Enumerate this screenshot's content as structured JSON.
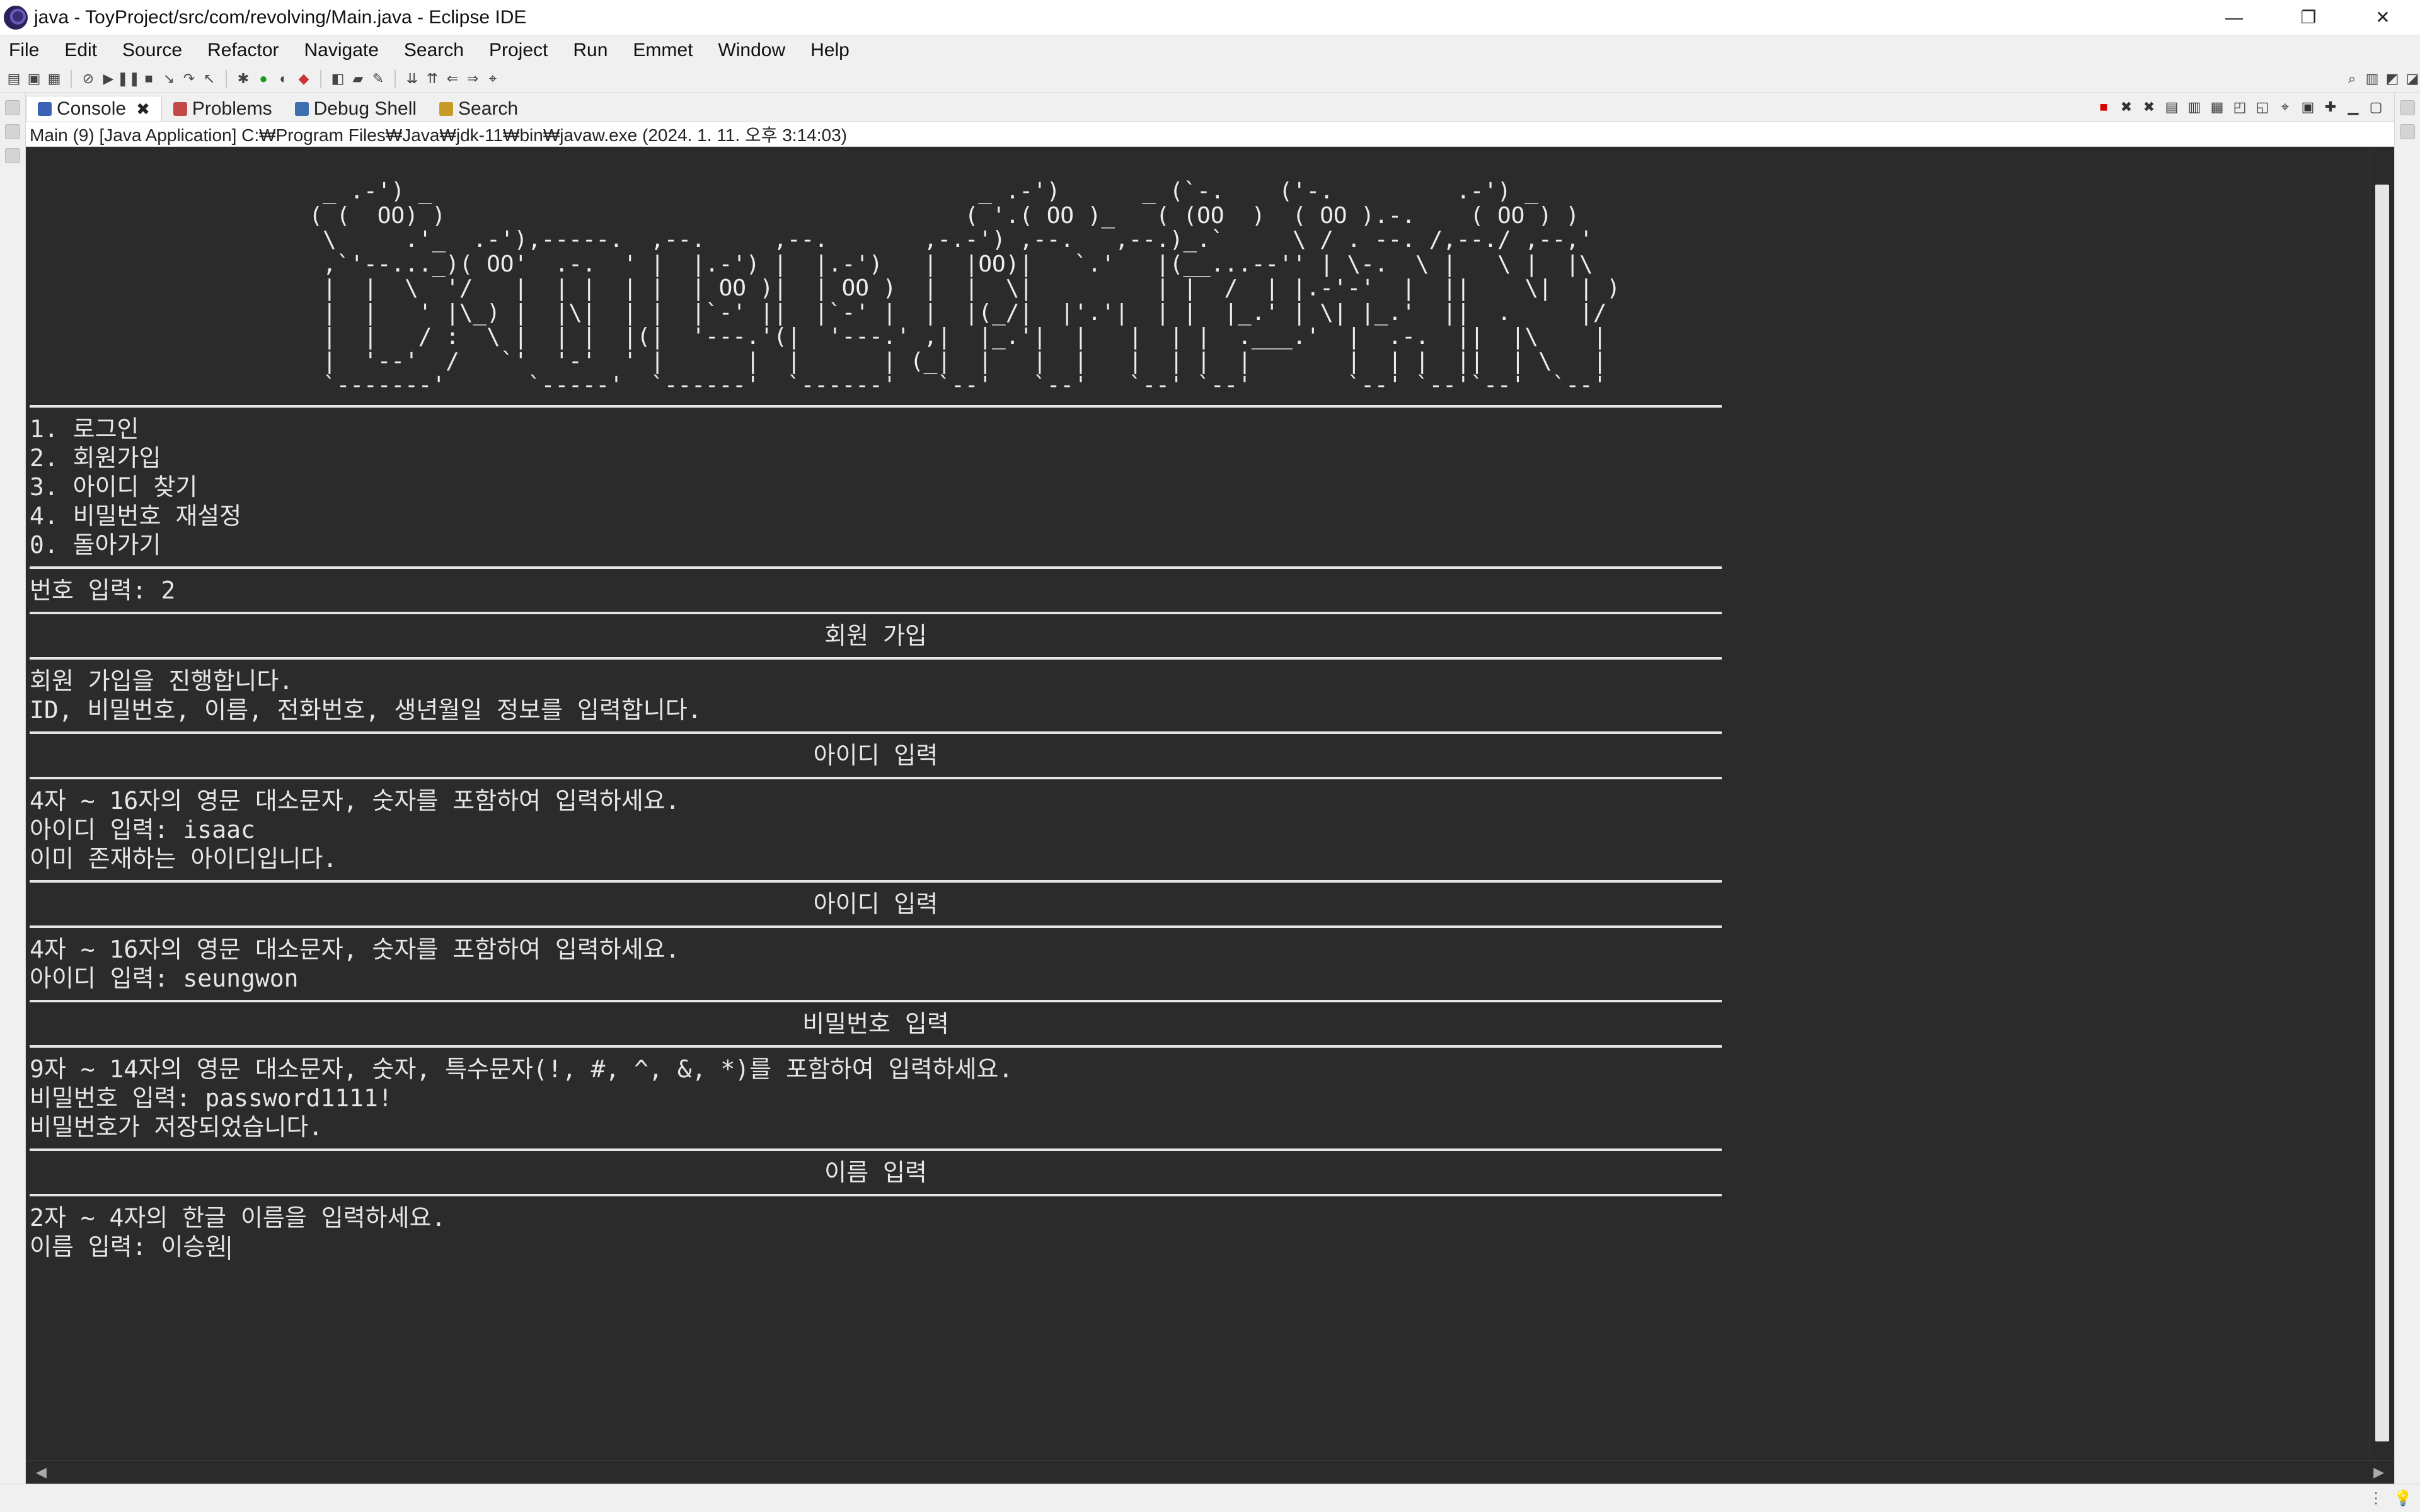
{
  "window": {
    "title": "java - ToyProject/src/com/revolving/Main.java - Eclipse IDE",
    "controls": {
      "minimize": "—",
      "maximize": "❐",
      "close": "✕"
    }
  },
  "menu": [
    "File",
    "Edit",
    "Source",
    "Refactor",
    "Navigate",
    "Search",
    "Project",
    "Run",
    "Emmet",
    "Window",
    "Help"
  ],
  "tabs": [
    {
      "label": "Console",
      "active": true,
      "icon": "console-icon"
    },
    {
      "label": "Problems",
      "active": false,
      "icon": "problems-icon"
    },
    {
      "label": "Debug Shell",
      "active": false,
      "icon": "debug-shell-icon"
    },
    {
      "label": "Search",
      "active": false,
      "icon": "search-icon"
    }
  ],
  "launch_info": "Main (9) [Java Application] C:₩Program Files₩Java₩jdk-11₩bin₩javaw.exe  (2024. 1. 11. 오후 3:14:03)",
  "console": {
    "ascii_banner": "   _ .-') _                                        _ .-')      _ (`-.    ('-.         .-') _\n  ( (  OO) )                                      ( '.( OO )_   ( (OO  )  ( OO ).-.    ( OO ) )\n   \\     .'_  .-'),-----.  ,--.     ,--.       ,-.-') ,--.   ,--.)_.`     \\ / . --. /,--./ ,--,'\n   ,`'--..._)( OO'  .-.  ' |  |.-') |  |.-')   |  |OO)|   `.'   |(__...--'' | \\-.  \\ |   \\ |  |\\\n   |  |  \\  '/   |  | |  | |  | OO )|  | OO )  |  |  \\|         | |  /  | |.-'-'  |  ||    \\|  | )\n   |  |   ' |\\_) |  |\\|  | |  |`-' ||  |`-' |  |  |(_/|  |'.'|  | |  |_.' | \\| |_.'  ||  .     |/\n   |  |   / :  \\ |  | |  |(|  '---.'(|  '---.' ,|  |_.'|  |   |  | |  .___.'  |  .-.  ||  |\\    |\n   |  '--'  /   `'  '-'  ' |      |  |      | (_|  |   |  |   |  | |  |       |  | |  ||  | \\   |\n   `-------'      `-----'  `------'  `------'   `--'   `--'   `--' `--'       `--' `--'`--'  `--'",
    "menu_lines": [
      "1. 로그인",
      "2. 회원가입",
      "3. 아이디 찾기",
      "4. 비밀번호 재설정",
      "0. 돌아가기"
    ],
    "number_input": "번호 입력: 2",
    "signup_header": "회원 가입",
    "signup_intro": [
      "회원 가입을 진행합니다.",
      "ID, 비밀번호, 이름, 전화번호, 생년월일 정보를 입력합니다."
    ],
    "id_header_1": "아이디 입력",
    "id_block_1": [
      "4자 ~ 16자의 영문 대소문자, 숫자를 포함하여 입력하세요.",
      "아이디 입력: isaac",
      "이미 존재하는 아이디입니다."
    ],
    "id_header_2": "아이디 입력",
    "id_block_2": [
      "4자 ~ 16자의 영문 대소문자, 숫자를 포함하여 입력하세요.",
      "아이디 입력: seungwon"
    ],
    "pw_header": "비밀번호 입력",
    "pw_block": [
      "9자 ~ 14자의 영문 대소문자, 숫자, 특수문자(!, #, ^, &, *)를 포함하여 입력하세요.",
      "비밀번호 입력: password1111!",
      "비밀번호가 저장되었습니다."
    ],
    "name_header": "이름 입력",
    "name_block": [
      "2자 ~ 4자의 한글 이름을 입력하세요.",
      "이름 입력: 이승원"
    ]
  },
  "colors": {
    "console_bg": "#2b2b2b",
    "console_fg": "#e6e6e6",
    "chrome": "#f0f0f0"
  }
}
